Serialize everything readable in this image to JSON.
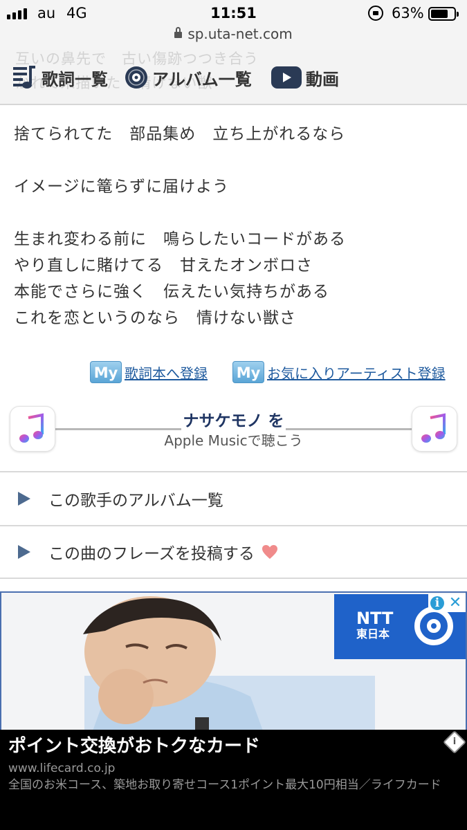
{
  "status_bar": {
    "carrier": "au",
    "network": "4G",
    "time": "11:51",
    "battery": "63%",
    "battery_level": 0.63,
    "url": "sp.uta-net.com"
  },
  "nav": {
    "ghost_line_1": "互いの鼻先で　古い傷跡つつき合う",
    "ghost_line_2": "かれて来描いた　情けない獣",
    "lyrics_list": "歌詞一覧",
    "album_list": "アルバム一覧",
    "video": "動画"
  },
  "lyrics": {
    "stanzas": [
      [
        "捨てられてた　部品集め　立ち上がれるなら"
      ],
      [
        "イメージに篭らずに届けよう"
      ],
      [
        "生まれ変わる前に　鳴らしたいコードがある",
        "やり直しに賭けてる　甘えたオンボロさ",
        "本能でさらに強く　伝えたい気持ちがある",
        "これを恋というのなら　情けない獣さ"
      ]
    ]
  },
  "my_links": {
    "badge": "My",
    "register_lyrics_book": "歌詞本へ登録",
    "register_favorite_artist": "お気に入りアーティスト登録"
  },
  "apple_music": {
    "song": "ナサケモノ を",
    "subtitle": "Apple Musicで聴こう"
  },
  "rows": {
    "album_list": "この歌手のアルバム一覧",
    "post_phrase": "この曲のフレーズを投稿する"
  },
  "ad": {
    "brand_line_1": "NTT",
    "brand_line_2": "東日本",
    "headline": "ポイント交換がおトクなカード",
    "domain": "www.lifecard.co.jp",
    "description": "全国のお米コース、築地お取り寄せコース1ポイント最大10円相当／ライフカード",
    "info_icon": "i",
    "close_icon": "✕"
  },
  "colors": {
    "nav_bg": "#f3f3f3",
    "link_blue": "#1e5a9e",
    "row_arrow": "#4d6a8f",
    "heart": "#f08b8b",
    "ntt_blue": "#1f62c9"
  }
}
